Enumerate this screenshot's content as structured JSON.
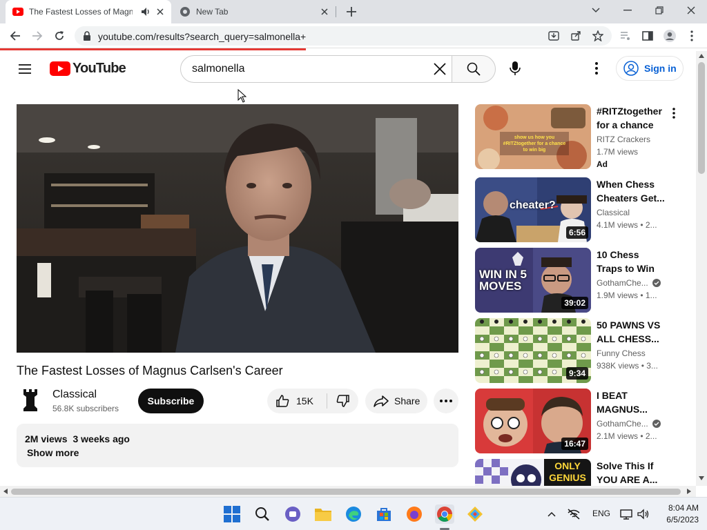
{
  "browser": {
    "tabs": [
      {
        "title": "The Fastest Losses of Magnus Carlsen's Career",
        "active": true
      },
      {
        "title": "New Tab",
        "active": false
      }
    ],
    "url": "youtube.com/results?search_query=salmonella+"
  },
  "youtube": {
    "logo_text": "YouTube",
    "search": {
      "value": "salmonella",
      "placeholder": "Search"
    },
    "sign_in": "Sign in",
    "brand_color": "#ff0000"
  },
  "video": {
    "title": "The Fastest Losses of Magnus Carlsen's Career",
    "channel": "Classical",
    "subscribers": "56.8K subscribers",
    "subscribe_label": "Subscribe",
    "likes": "15K",
    "share_label": "Share",
    "views": "2M views",
    "age": "3 weeks ago",
    "show_more": "Show more"
  },
  "recommendations": [
    {
      "title": "#RITZtogether for a chance t...",
      "channel": "RITZ Crackers",
      "views": "1.7M views",
      "badge": "Ad",
      "thumb_text": "show us how you #RITZtogether for a chance to win big"
    },
    {
      "title": "When Chess Cheaters Get...",
      "channel": "Classical",
      "views": "4.1M views  • 2...",
      "duration": "6:56",
      "thumb_text": "cheater?"
    },
    {
      "title": "10 Chess Traps to Win FAST!!",
      "channel": "GothamChe...",
      "views": "1.9M views  • 1...",
      "duration": "39:02",
      "thumb_text": "WIN IN 5 MOVES",
      "verified": true
    },
    {
      "title": "50 PAWNS VS ALL CHESS...",
      "channel": "Funny Chess",
      "views": "938K views  • 3...",
      "duration": "9:34"
    },
    {
      "title": "I BEAT MAGNUS...",
      "channel": "GothamChe...",
      "views": "2.1M views  • 2...",
      "duration": "16:47",
      "verified": true
    },
    {
      "title": "Solve This If YOU ARE A...",
      "thumb_text": "ONLY GENIUS"
    }
  ],
  "taskbar": {
    "language": "ENG",
    "time": "8:04 AM",
    "date": "6/5/2023"
  }
}
